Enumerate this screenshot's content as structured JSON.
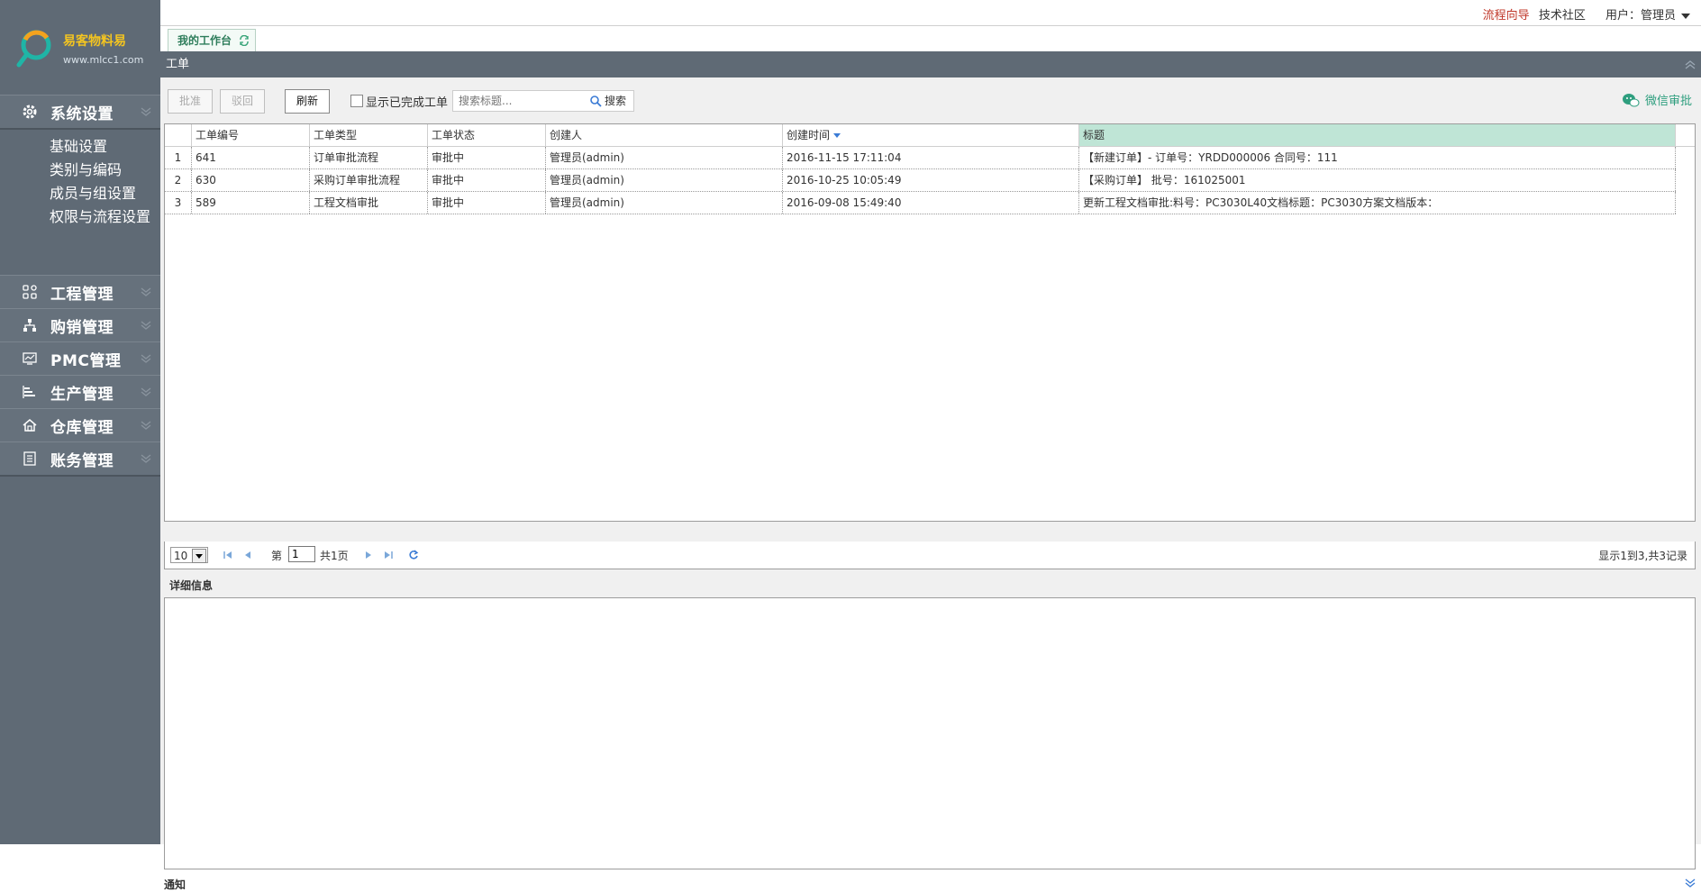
{
  "sidebar": {
    "logo_text": "易客物料易",
    "logo_url": "www.mlcc1.com",
    "sections": [
      {
        "label": "系统设置",
        "icon": "gear-icon"
      },
      {
        "label": "工程管理",
        "icon": "grid-icon"
      },
      {
        "label": "购销管理",
        "icon": "org-chart-icon"
      },
      {
        "label": "PMC管理",
        "icon": "monitor-icon"
      },
      {
        "label": "生产管理",
        "icon": "bar-chart-icon"
      },
      {
        "label": "仓库管理",
        "icon": "home-icon"
      },
      {
        "label": "账务管理",
        "icon": "ledger-icon"
      }
    ],
    "sub_items": [
      "基础设置",
      "类别与编码",
      "成员与组设置",
      "权限与流程设置"
    ]
  },
  "topbar": {
    "flow_guide": "流程向导",
    "community": "技术社区",
    "user": "用户：管理员"
  },
  "tabs": [
    {
      "label": "我的工作台"
    }
  ],
  "panel": {
    "title": "工单",
    "toolbar": {
      "approve": "批准",
      "reject": "驳回",
      "refresh": "刷新",
      "show_completed": "显示已完成工单",
      "search_placeholder": "搜索标题...",
      "search": "搜索",
      "wechat": "微信审批"
    },
    "table": {
      "columns": [
        "工单编号",
        "工单类型",
        "工单状态",
        "创建人",
        "创建时间",
        "标题"
      ],
      "rows": [
        {
          "num": "1",
          "id": "641",
          "type": "订单审批流程",
          "status": "审批中",
          "creator": "管理员(admin)",
          "time": "2016-11-15 17:11:04",
          "title": "【新建订单】- 订单号：YRDD000006 合同号：111"
        },
        {
          "num": "2",
          "id": "630",
          "type": "采购订单审批流程",
          "status": "审批中",
          "creator": "管理员(admin)",
          "time": "2016-10-25 10:05:49",
          "title": "【采购订单】 批号：161025001"
        },
        {
          "num": "3",
          "id": "589",
          "type": "工程文档审批",
          "status": "审批中",
          "creator": "管理员(admin)",
          "time": "2016-09-08 15:49:40",
          "title": "更新工程文档审批:料号：PC3030L40文档标题：PC3030方案文档版本："
        }
      ]
    },
    "pager": {
      "page_size": "10",
      "page_prefix": "第",
      "page_value": "1",
      "page_total": "共1页",
      "info": "显示1到3,共3记录"
    },
    "detail_title": "详细信息",
    "notice_title": "通知"
  }
}
